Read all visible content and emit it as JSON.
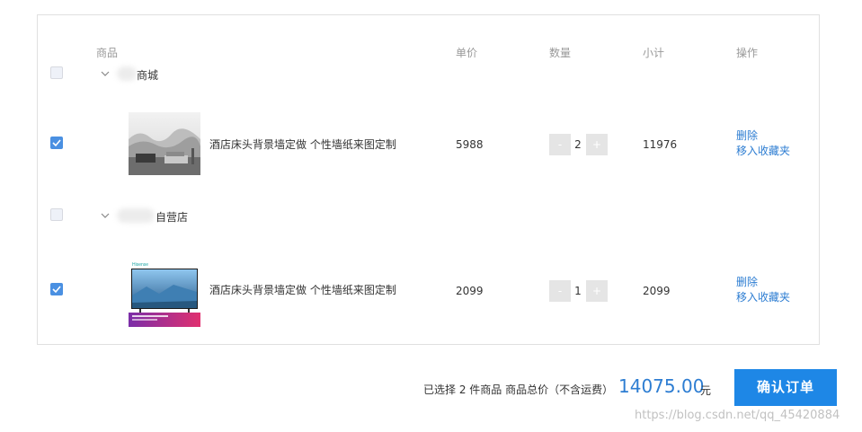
{
  "table": {
    "headers": {
      "product": "商品",
      "unit_price": "单价",
      "quantity": "数量",
      "subtotal": "小计",
      "actions": "操作"
    }
  },
  "stores": [
    {
      "name": "商城",
      "selected": false,
      "items": [
        {
          "name": "酒店床头背景墙定做 个性墙纸来图定制",
          "price": "5988",
          "quantity": "2",
          "subtotal": "11976",
          "selected": true,
          "thumbnail": "misty-mountain-mural-icon",
          "delete_label": "删除",
          "favorite_label": "移入收藏夹"
        }
      ]
    },
    {
      "name": "自营店",
      "selected": false,
      "items": [
        {
          "name": "酒店床头背景墙定做 个性墙纸来图定制",
          "price": "2099",
          "quantity": "1",
          "subtotal": "2099",
          "selected": true,
          "thumbnail": "hisense-tv-icon",
          "thumbnail_brand": "Hisense",
          "delete_label": "删除",
          "favorite_label": "移入收藏夹"
        }
      ]
    }
  ],
  "stepper": {
    "minus": "-",
    "plus": "+"
  },
  "footer": {
    "summary": "已选择 2 件商品 商品总价（不含运费）",
    "total": "14075.00",
    "currency": "元",
    "confirm_label": "确认订单"
  },
  "watermark": "https://blog.csdn.net/qq_45420884",
  "colors": {
    "accent": "#1e87e6",
    "link": "#2d7dd2",
    "checkbox": "#4a90e2"
  }
}
